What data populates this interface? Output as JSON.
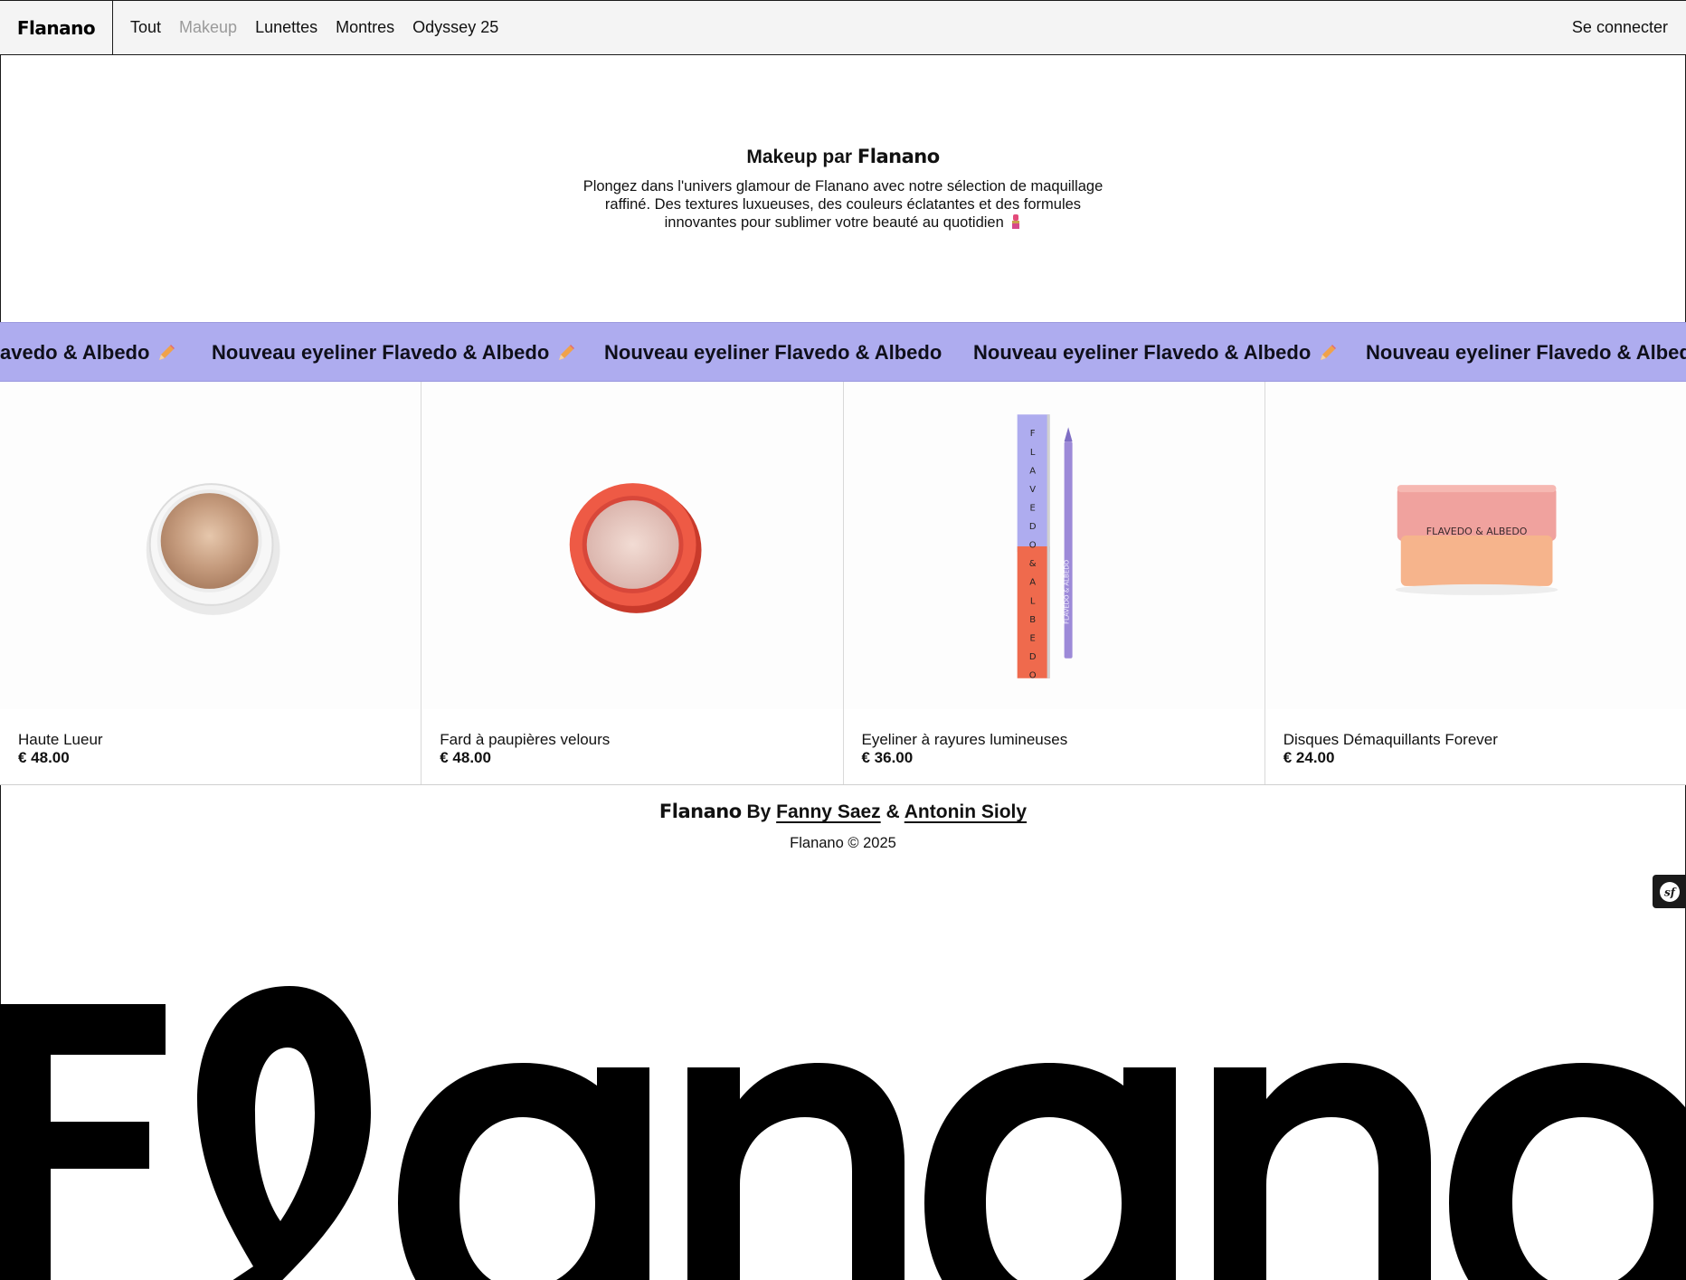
{
  "header": {
    "logo": "Flanano",
    "nav": [
      "Tout",
      "Makeup",
      "Lunettes",
      "Montres",
      "Odyssey 25"
    ],
    "active_nav": "Makeup",
    "login": "Se connecter"
  },
  "intro": {
    "title_prefix": "Makeup par ",
    "title_brand": "Flanano",
    "text": "Plongez dans l'univers glamour de Flanano avec notre sélection de maquillage raffiné. Des textures luxueuses, des couleurs éclatantes et des formules innovantes pour sublimer votre beauté au quotidien",
    "icon": "lipstick-icon"
  },
  "marquee": {
    "text": "Nouveau eyeliner Flavedo & Albedo",
    "first_partial": "avedo & Albedo",
    "background": "#aeacef",
    "icon": "pencil-icon"
  },
  "products": [
    {
      "name": "Haute Lueur",
      "price": "€ 48.00"
    },
    {
      "name": "Fard à paupières velours",
      "price": "€ 48.00"
    },
    {
      "name": "Eyeliner à rayures lumineuses",
      "price": "€ 36.00"
    },
    {
      "name": "Disques Démaquillants Forever",
      "price": "€ 24.00"
    }
  ],
  "product_labels": {
    "eyeliner_box_letters": "FLAVEDO&ALBEDO",
    "eyeliner_pencil": "FLAVEDO & ALBEDO",
    "jar": "FLAVEDO & ALBEDO"
  },
  "footer": {
    "brand": "Flanano",
    "by": " By ",
    "author1": "Fanny Saez",
    "amp": " & ",
    "author2": "Antonin Sioly",
    "copyright": "Flanano © 2025"
  },
  "giant_logo": "Flanano",
  "colors": {
    "accent": "#aeacef",
    "header_bg": "#f4f4f4",
    "text": "#111111"
  }
}
